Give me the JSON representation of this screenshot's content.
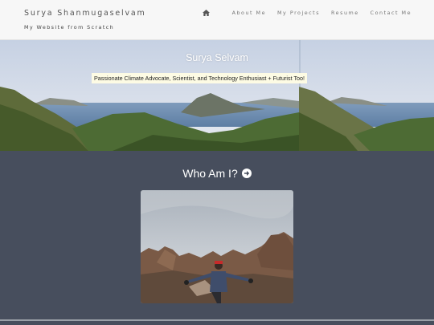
{
  "header": {
    "brand": "Surya Shanmugaselvam",
    "tagline": "My Website from Scratch",
    "nav": {
      "home_icon": "home-icon",
      "links": [
        "About Me",
        "My Projects",
        "Resume",
        "Contact Me"
      ]
    }
  },
  "hero": {
    "title": "Surya Selvam",
    "subtitle": "Passionate Climate Advocate, Scientist, and Technology Enthusiast + Futurist Too!"
  },
  "about": {
    "heading": "Who Am I?",
    "arrow_icon": "arrow-circle-right-icon"
  },
  "colors": {
    "header_bg": "#f7f7f7",
    "section_bg": "#474e5d",
    "subtitle_bg": "#fdfbe4"
  }
}
